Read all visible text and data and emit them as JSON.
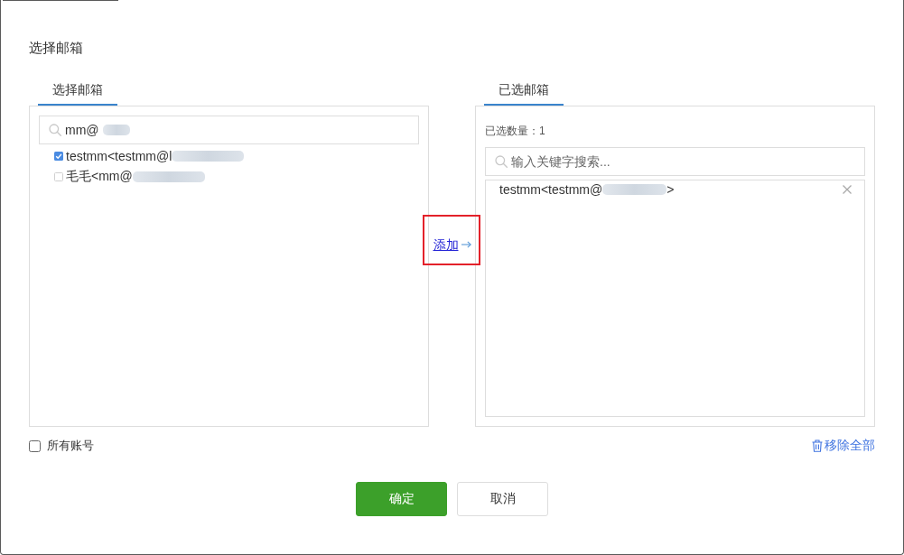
{
  "dialog": {
    "title": "选择邮箱"
  },
  "left_panel": {
    "tab": {
      "label": "选择邮箱",
      "selected": true
    },
    "search": {
      "value": "mm@",
      "redacted": true
    },
    "contacts": [
      {
        "text": "testmm<testmm@l",
        "redacted": true,
        "checked": true
      },
      {
        "text": "毛毛<mm@",
        "redacted": true,
        "checked": false
      }
    ]
  },
  "transfer": {
    "label": "添加",
    "highlighted": true
  },
  "right_panel": {
    "tab": {
      "label": "已选邮箱",
      "selected": true
    },
    "count_label": "已选数量：1",
    "search": {
      "placeholder": "输入关键字搜索..."
    },
    "selected": [
      {
        "text": "testmm<testmm@",
        "redacted": true,
        "suffix": ">"
      }
    ]
  },
  "all_accounts": {
    "label": "所有账号",
    "checked": false
  },
  "remove_all": {
    "label": "移除全部"
  },
  "buttons": [
    {
      "label": "确定",
      "kind": "primary"
    },
    {
      "label": "取消",
      "kind": "default"
    }
  ]
}
